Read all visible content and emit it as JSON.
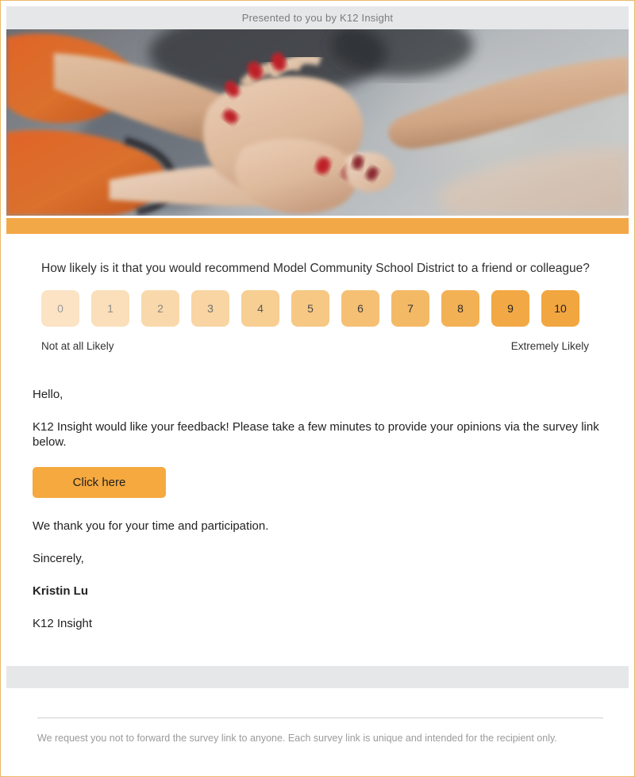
{
  "theme": {
    "border_color": "#eab86a",
    "accent_orange": "#f3a847",
    "button_orange": "#f5a93f",
    "band_gray": "#e6e7e8"
  },
  "header": {
    "preheader_text": "Presented to you by K12 Insight"
  },
  "hero": {
    "icon": "team-hands-stacked-photo",
    "alt": "Group of people stacking hands together"
  },
  "survey": {
    "question": "How likely is it that you would recommend Model Community School District to a friend or colleague?",
    "scale": [
      {
        "label": "0",
        "bg": "#fbe3c4",
        "fg": "#9b9b9b"
      },
      {
        "label": "1",
        "bg": "#fadfba",
        "fg": "#8f8f8f"
      },
      {
        "label": "2",
        "bg": "#f9d9ab",
        "fg": "#858585"
      },
      {
        "label": "3",
        "bg": "#f8d5a2",
        "fg": "#6f6f6f"
      },
      {
        "label": "4",
        "bg": "#f7cf93",
        "fg": "#5a5a5a"
      },
      {
        "label": "5",
        "bg": "#f6c884",
        "fg": "#4a4a4a"
      },
      {
        "label": "6",
        "bg": "#f5c074",
        "fg": "#3d3d3d"
      },
      {
        "label": "7",
        "bg": "#f4b965",
        "fg": "#333333"
      },
      {
        "label": "8",
        "bg": "#f3b155",
        "fg": "#2b2b2b"
      },
      {
        "label": "9",
        "bg": "#f2a945",
        "fg": "#232323"
      },
      {
        "label": "10",
        "bg": "#f1a63f",
        "fg": "#1f1f1f"
      }
    ],
    "anchor_low": "Not at all Likely",
    "anchor_high": "Extremely Likely"
  },
  "letter": {
    "greeting": "Hello,",
    "intro": "K12 Insight would like your feedback! Please take a few minutes to provide your opinions via the survey link below.",
    "cta_label": "Click here",
    "thanks": "We thank you for your time and participation.",
    "closing": "Sincerely,",
    "sender_name": "Kristin Lu",
    "sender_org": "K12 Insight"
  },
  "footer": {
    "disclaimer": "We request you not to forward the survey link to anyone. Each survey link is unique and intended for the recipient only."
  }
}
